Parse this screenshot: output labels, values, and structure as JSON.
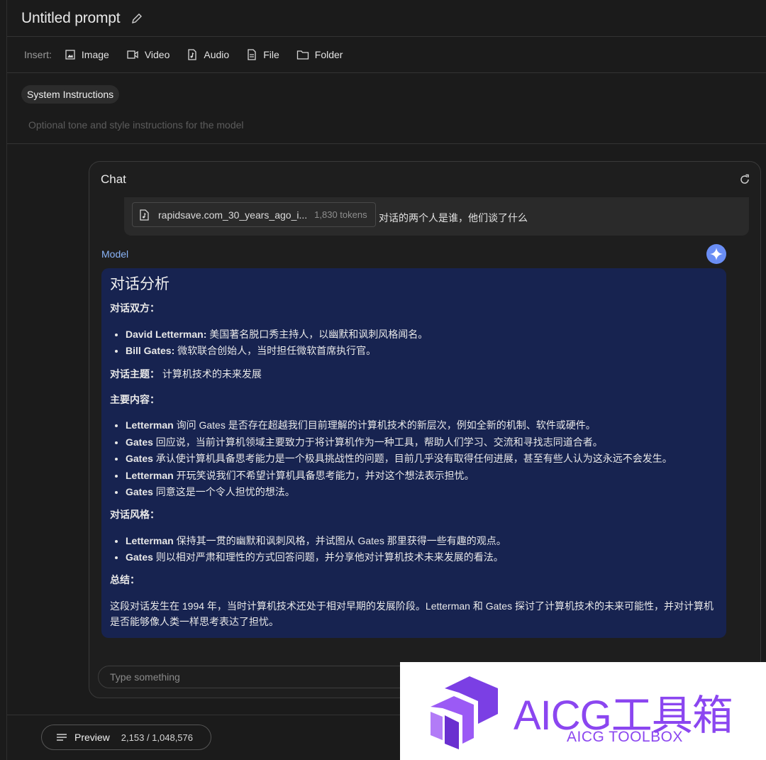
{
  "header": {
    "title": "Untitled prompt"
  },
  "insert_bar": {
    "label": "Insert:",
    "items": [
      {
        "label": "Image",
        "icon": "image-icon"
      },
      {
        "label": "Video",
        "icon": "video-icon"
      },
      {
        "label": "Audio",
        "icon": "audio-file-icon"
      },
      {
        "label": "File",
        "icon": "file-icon"
      },
      {
        "label": "Folder",
        "icon": "folder-icon"
      }
    ]
  },
  "system_instructions": {
    "chip": "System Instructions",
    "placeholder": "Optional tone and style instructions for the model"
  },
  "chat": {
    "title": "Chat",
    "user_turn": {
      "file_name": "rapidsave.com_30_years_ago_i...",
      "tokens": "1,830 tokens",
      "text": "对话的两个人是谁，他们谈了什么"
    },
    "model_label": "Model",
    "response": {
      "heading": "对话分析",
      "parties_title": "对话双方：",
      "parties": [
        {
          "name": "David Letterman:",
          "desc": " 美国著名脱口秀主持人，以幽默和讽刺风格闻名。"
        },
        {
          "name": "Bill Gates:",
          "desc": " 微软联合创始人，当时担任微软首席执行官。"
        }
      ],
      "topic_label": "对话主题：",
      "topic_value": " 计算机技术的未来发展",
      "content_title": "主要内容：",
      "content": [
        {
          "name": "Letterman",
          "desc": " 询问 Gates 是否存在超越我们目前理解的计算机技术的新层次，例如全新的机制、软件或硬件。"
        },
        {
          "name": "Gates",
          "desc": " 回应说，当前计算机领域主要致力于将计算机作为一种工具，帮助人们学习、交流和寻找志同道合者。"
        },
        {
          "name": "Gates",
          "desc": " 承认使计算机具备思考能力是一个极具挑战性的问题，目前几乎没有取得任何进展，甚至有些人认为这永远不会发生。"
        },
        {
          "name": "Letterman",
          "desc": " 开玩笑说我们不希望计算机具备思考能力，并对这个想法表示担忧。"
        },
        {
          "name": "Gates",
          "desc": " 同意这是一个令人担忧的想法。"
        }
      ],
      "style_title": "对话风格：",
      "style": [
        {
          "name": "Letterman",
          "desc": " 保持其一贯的幽默和讽刺风格，并试图从 Gates 那里获得一些有趣的观点。"
        },
        {
          "name": "Gates",
          "desc": " 则以相对严肃和理性的方式回答问题，并分享他对计算机技术未来发展的看法。"
        }
      ],
      "summary_title": "总结：",
      "summary": "这段对话发生在 1994 年，当时计算机技术还处于相对早期的发展阶段。Letterman 和 Gates 探讨了计算机技术的未来可能性，并对计算机是否能够像人类一样思考表达了担忧。"
    },
    "input_placeholder": "Type something"
  },
  "footer": {
    "preview_label": "Preview",
    "token_count": "2,153 / 1,048,576"
  },
  "watermark": {
    "title": "AICG工具箱",
    "subtitle": "AICG TOOLBOX",
    "color": "#8b46f0"
  }
}
